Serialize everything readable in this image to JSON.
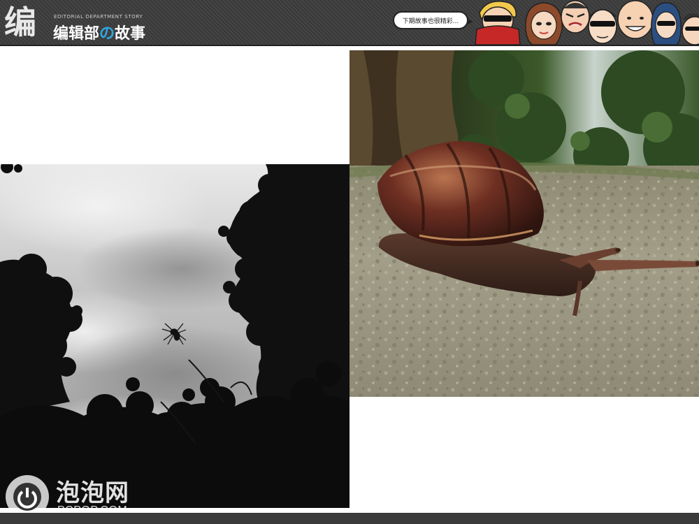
{
  "header": {
    "logo_mark": "编",
    "subtitle": "EDITORIAL DEPARTMENT STORY",
    "title_part1": "编辑部",
    "title_accent": "の",
    "title_part2": "故事",
    "speech_bubble": "下期故事也很精彩...",
    "colors": {
      "background": "#3a3a3a",
      "accent": "#2ea7e0"
    }
  },
  "photos": {
    "left": {
      "icon": "sky-spider-photo"
    },
    "right": {
      "icon": "snail-photo"
    }
  },
  "watermark": {
    "brand": "泡泡网",
    "domain": "PCPOP.COM",
    "icon": "power-icon"
  }
}
